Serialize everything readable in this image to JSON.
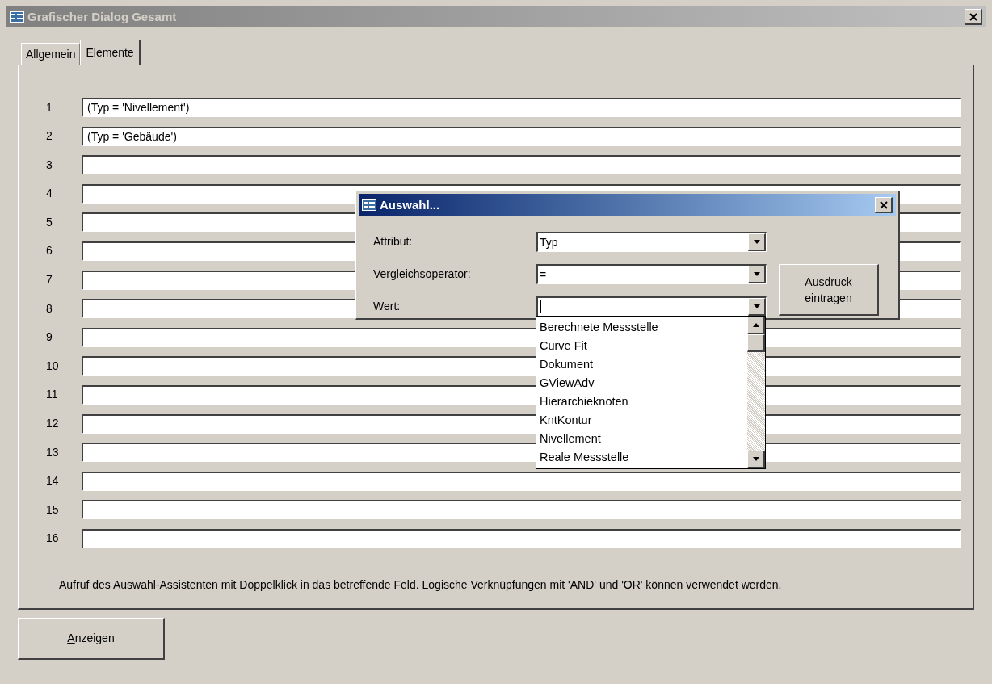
{
  "window": {
    "title": "Grafischer Dialog Gesamt"
  },
  "tabs": [
    {
      "label": "Allgemein",
      "selected": false
    },
    {
      "label": "Elemente",
      "selected": true
    }
  ],
  "rows": [
    {
      "number": "1",
      "value": "(Typ = 'Nivellement')"
    },
    {
      "number": "2",
      "value": "(Typ = 'Gebäude')"
    },
    {
      "number": "3"
    },
    {
      "number": "4"
    },
    {
      "number": "5"
    },
    {
      "number": "6"
    },
    {
      "number": "7"
    },
    {
      "number": "8"
    },
    {
      "number": "9"
    },
    {
      "number": "10"
    },
    {
      "number": "11"
    },
    {
      "number": "12"
    },
    {
      "number": "13"
    },
    {
      "number": "14"
    },
    {
      "number": "15"
    },
    {
      "number": "16"
    }
  ],
  "hint": "Aufruf des Auswahl-Assistenten mit Doppelklick in das betreffende Feld. Logische Verknüpfungen mit 'AND' und 'OR' können verwendet werden.",
  "buttons": [
    "Anzeigen"
  ],
  "dialog": {
    "title": "Auswahl...",
    "fields": [
      {
        "label": "Attribut:",
        "value": "Typ",
        "focused": false
      },
      {
        "label": "Vergleichsoperator:",
        "value": "=",
        "focused": false
      },
      {
        "label": "Wert:",
        "focused": true
      }
    ],
    "button": "Ausdruck eintragen",
    "list": [
      "Berechnete Messstelle",
      "Curve Fit",
      "Dokument",
      "GViewAdv",
      "Hierarchieknoten",
      "KntKontur",
      "Nivellement",
      "Reale Messstelle"
    ]
  }
}
